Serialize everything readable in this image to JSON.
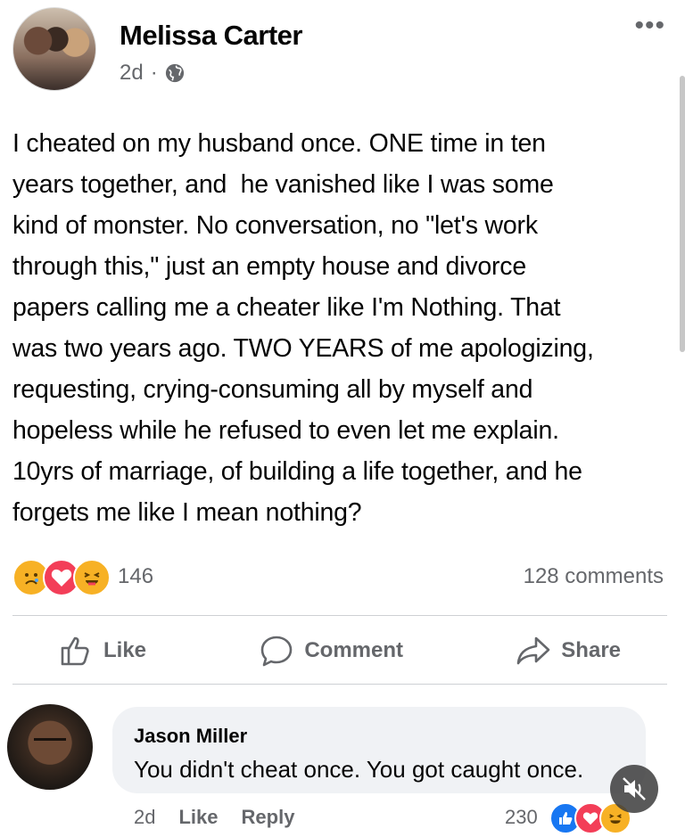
{
  "post": {
    "author": "Melissa Carter",
    "time": "2d",
    "separator": "·",
    "privacy_icon": "globe-icon",
    "more_label": "•••",
    "text": "I cheated on my husband once. ONE time in ten\nyears together, and  he vanished like I was some\nkind of monster. No conversation, no \"let's work\nthrough this,\" just an empty house and divorce\npapers calling me a cheater like I'm Nothing. That\nwas two years ago. TWO YEARS of me apologizing,\nrequesting, crying-consuming all by myself and\nhopeless while he refused to even let me explain.\n10yrs of marriage, of building a life together, and he\nforgets me like I mean nothing?",
    "reactions": {
      "icons": [
        "sad-reaction-icon",
        "love-reaction-icon",
        "haha-reaction-icon"
      ],
      "count": "146"
    },
    "comments_count": "128 comments"
  },
  "actions": {
    "like": "Like",
    "comment": "Comment",
    "share": "Share"
  },
  "comment": {
    "author": "Jason Miller",
    "text": "You didn't cheat once. You got caught once.",
    "time": "2d",
    "like": "Like",
    "reply": "Reply",
    "reaction_count": "230",
    "reaction_icons": [
      "like-reaction-icon",
      "love-reaction-icon",
      "haha-reaction-icon"
    ]
  },
  "colors": {
    "text": "#050505",
    "secondary": "#65676b",
    "bubble": "#f0f2f5",
    "like_blue": "#1877f2",
    "love_red": "#f33e58",
    "emoji_yellow": "#f7b125"
  }
}
